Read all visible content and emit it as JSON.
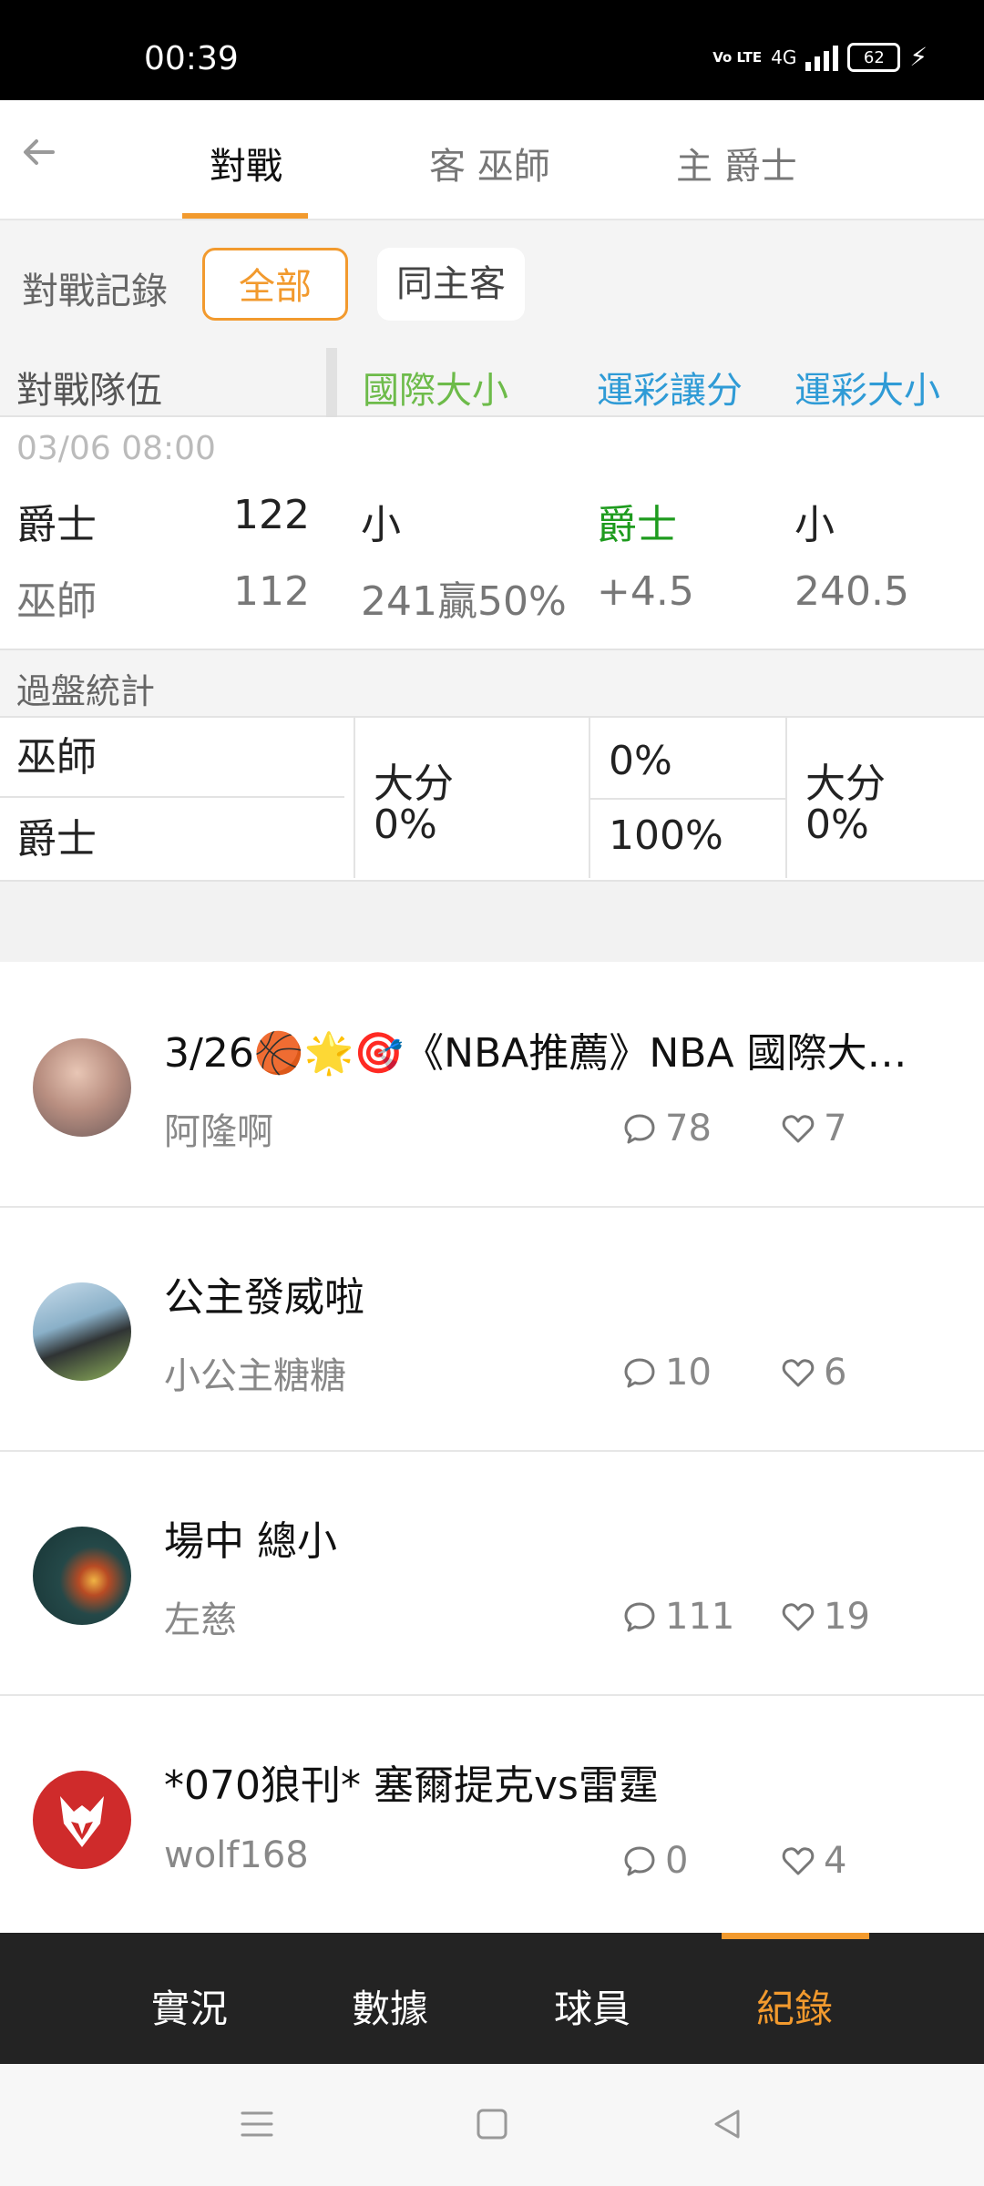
{
  "status": {
    "time": "00:39",
    "volte": "Vo LTE",
    "network": "4G",
    "battery": "62"
  },
  "header": {
    "tabs": [
      "對戰",
      "客 巫師",
      "主 爵士"
    ]
  },
  "filters": {
    "label": "對戰記錄",
    "all": "全部",
    "same_home_away": "同主客"
  },
  "table": {
    "headers": [
      "對戰隊伍",
      "國際大小",
      "運彩讓分",
      "運彩大小"
    ]
  },
  "match": {
    "date": "03/06 08:00",
    "home": {
      "team": "爵士",
      "score": "122",
      "intl": "小",
      "spread": "爵士",
      "total": "小"
    },
    "away": {
      "team": "巫師",
      "score": "112",
      "intl": "241贏50%",
      "spread": "+4.5",
      "total": "240.5"
    }
  },
  "stats": {
    "title": "過盤統計",
    "teams": [
      "巫師",
      "爵士"
    ],
    "intl_label": "大分",
    "intl_value": "0%",
    "spread_top": "0%",
    "spread_bottom": "100%",
    "total_label": "大分",
    "total_value": "0%"
  },
  "posts": [
    {
      "title": "3/26🏀🌟🎯《NBA推薦》NBA 國際大…",
      "author": "阿隆啊",
      "comments": "78",
      "likes": "7"
    },
    {
      "title": "公主發威啦",
      "author": "小公主糖糖",
      "comments": "10",
      "likes": "6"
    },
    {
      "title": "場中 總小",
      "author": "左慈",
      "comments": "111",
      "likes": "19"
    },
    {
      "title": "*070狼刊* 塞爾提克vs雷霆",
      "author": "wolf168",
      "comments": "0",
      "likes": "4"
    }
  ],
  "bottom_tabs": [
    "實況",
    "數據",
    "球員",
    "紀錄"
  ],
  "colors": {
    "accent": "#f29a2e",
    "green_header": "#6dbb4a",
    "blue_header": "#2f9bd6",
    "green_text": "#1e9b1e"
  }
}
